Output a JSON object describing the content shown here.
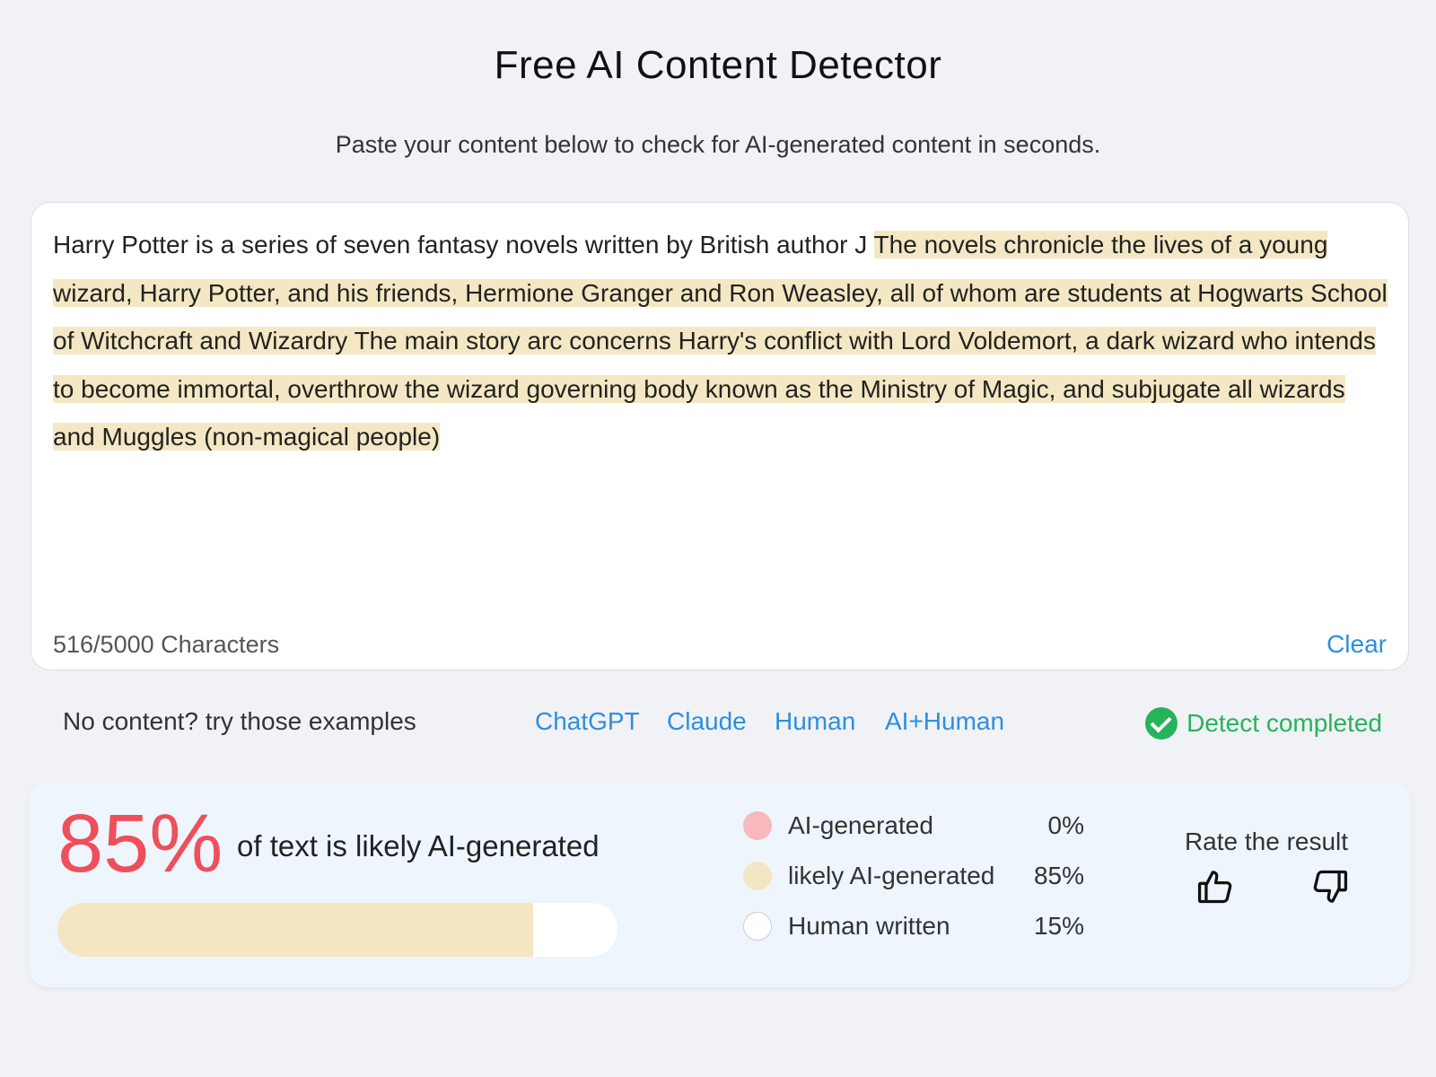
{
  "header": {
    "title": "Free AI Content Detector",
    "subtitle": "Paste your content below to check for AI-generated content in seconds."
  },
  "editor": {
    "plain_text": "Harry Potter is a series of seven fantasy novels written by British author J ",
    "highlighted_text": "The novels chronicle the lives of a young wizard, Harry Potter, and his friends, Hermione Granger and Ron Weasley, all of whom are students at Hogwarts School of Witchcraft and Wizardry The main story arc concerns Harry's conflict with Lord Voldemort, a dark wizard who intends to become immortal, overthrow the wizard governing body known as the Ministry of Magic, and subjugate all wizards and Muggles (non-magical people)",
    "char_count": "516/5000 Characters",
    "clear_label": "Clear",
    "highlight_color": "#f4e8c4"
  },
  "examples": {
    "label": "No content? try those examples",
    "links": [
      "ChatGPT",
      "Claude",
      "Human",
      "AI+Human"
    ],
    "status": "Detect completed",
    "status_icon": "check-circle-icon",
    "status_color": "#27b35a"
  },
  "result": {
    "percent": "85%",
    "description": "of text is likely AI-generated",
    "progress_fraction": 0.85,
    "legend": [
      {
        "label": "AI-generated",
        "value": "0%",
        "color": "#f7b9bd"
      },
      {
        "label": "likely AI-generated",
        "value": "85%",
        "color": "#f4e6c2"
      },
      {
        "label": "Human written",
        "value": "15%",
        "color": "#ffffff"
      }
    ],
    "rate_label": "Rate the result",
    "rate_icons": [
      "thumbs-up-icon",
      "thumbs-down-icon"
    ]
  }
}
